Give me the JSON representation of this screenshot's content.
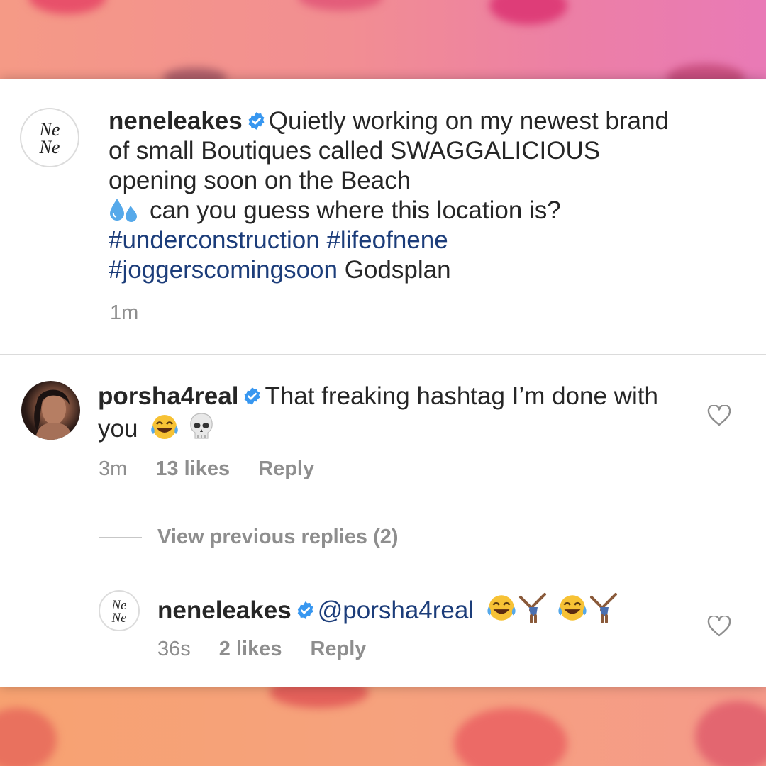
{
  "post": {
    "username": "neneleakes",
    "caption_text_1": "Quietly working on my newest brand of small Boutiques called SWAGGALICIOUS opening soon on the Beach",
    "caption_text_2": "can you guess where this location is?",
    "hashtag_1": "#underconstruction",
    "hashtag_2": "#lifeofnene",
    "hashtag_3": "#joggerscomingsoon",
    "caption_text_3": "Godsplan",
    "time": "1m",
    "avatar_logo_text": "Ne Ne"
  },
  "comment_1": {
    "username": "porsha4real",
    "text": "That freaking hashtag I’m done with you",
    "time": "3m",
    "likes": "13 likes",
    "reply_label": "Reply"
  },
  "view_previous_replies": "View previous replies (2)",
  "reply_1": {
    "username": "neneleakes",
    "mention": "@porsha4real",
    "time": "36s",
    "likes": "2 likes",
    "reply_label": "Reply",
    "avatar_logo_text": "Ne Ne"
  },
  "icons": {
    "verified_badge": "verified-badge-icon",
    "heart": "heart-outline-icon",
    "emoji_sweat": "sweat-droplets-icon",
    "emoji_laugh": "tears-of-joy-icon",
    "emoji_skull": "skull-icon",
    "emoji_cartwheel": "cartwheel-icon"
  },
  "colors": {
    "hashtag": "#1c3d7a",
    "verified": "#3897f0",
    "meta": "#8e8e8e",
    "text": "#262626"
  }
}
